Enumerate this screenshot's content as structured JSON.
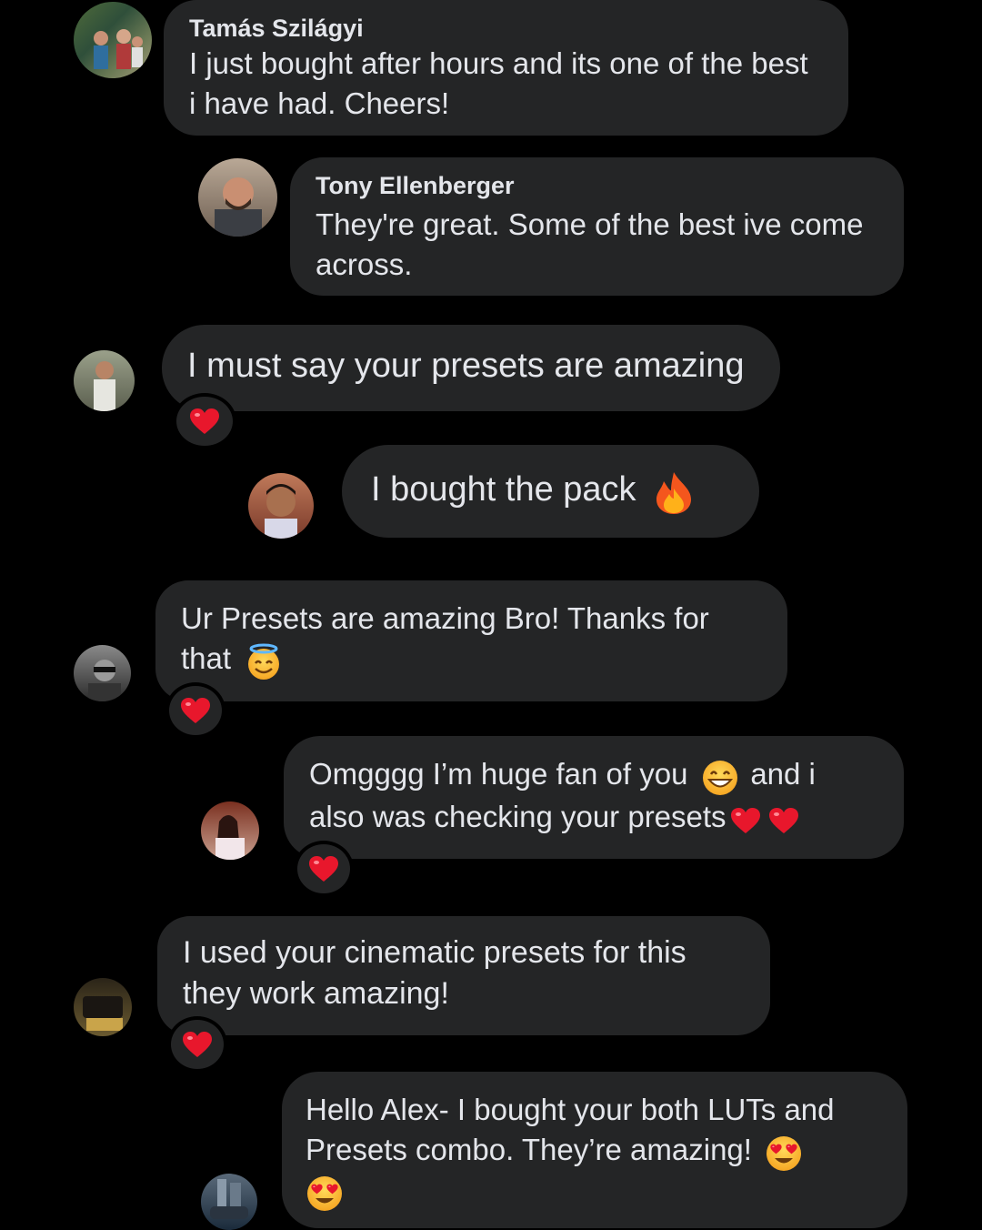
{
  "messages": [
    {
      "name": "Tamás Szilágyi",
      "text": "I just bought after hours and its one of the best i have had. Cheers!"
    },
    {
      "name": "Tony Ellenberger",
      "text": "They're great. Some of the best ive come across."
    },
    {
      "text": "I must say your presets are amazing"
    },
    {
      "text": "I bought the pack"
    },
    {
      "line1": "Ur Presets are amazing Bro! Thanks for",
      "line2": "that"
    },
    {
      "line1a": "Omgggg I’m huge fan of you",
      "line1b": "and i",
      "line2": "also was checking your presets"
    },
    {
      "text": "I used your cinematic presets for this they work amazing!"
    },
    {
      "text": "Hello Alex- I bought your both LUTs and Presets combo. They’re amazing!"
    }
  ],
  "colors": {
    "background": "#000000",
    "bubble": "#242526",
    "text": "#e4e6eb",
    "heart": "#e0245e"
  },
  "icons": {
    "reaction": "red-heart-icon",
    "fire": "fire-emoji",
    "halo": "smiling-face-with-halo-emoji",
    "grin": "grinning-face-emoji",
    "heart_eyes": "heart-eyes-emoji"
  }
}
